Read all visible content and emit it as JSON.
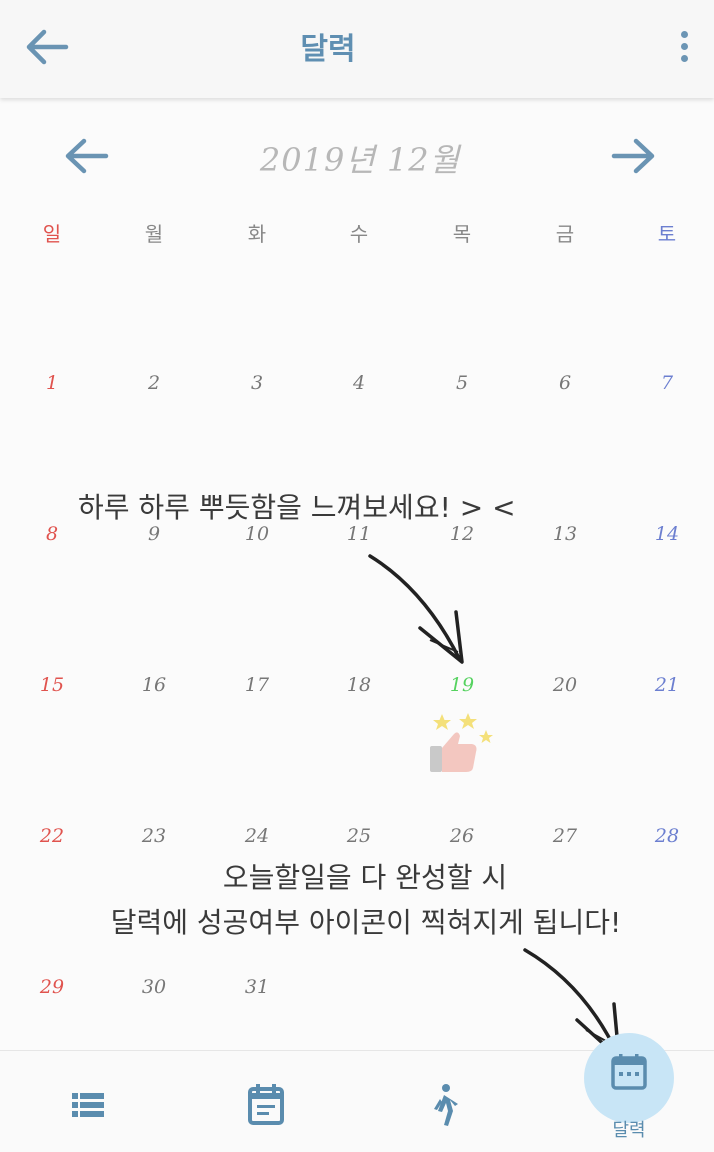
{
  "header": {
    "title": "달력",
    "back_icon": "arrow-left-icon",
    "more_icon": "more-vertical-icon"
  },
  "month_nav": {
    "label": "2019년 12월",
    "prev_icon": "arrow-left-icon",
    "next_icon": "arrow-right-icon"
  },
  "weekdays": [
    "일",
    "월",
    "화",
    "수",
    "목",
    "금",
    "토"
  ],
  "weeks": [
    [
      "1",
      "2",
      "3",
      "4",
      "5",
      "6",
      "7"
    ],
    [
      "8",
      "9",
      "10",
      "11",
      "12",
      "13",
      "14"
    ],
    [
      "15",
      "16",
      "17",
      "18",
      "19",
      "20",
      "21"
    ],
    [
      "22",
      "23",
      "24",
      "25",
      "26",
      "27",
      "28"
    ],
    [
      "29",
      "30",
      "31",
      "",
      "",
      "",
      ""
    ]
  ],
  "today": "19",
  "success_badge_icon": "thumbs-up-stars-icon",
  "tips": {
    "tip1": "하루 하루 뿌듯함을 느껴보세요! > <",
    "tip2_line1": "오늘할일을 다 완성할 시",
    "tip2_line2": "달력에 성공여부 아이콘이 찍혀지게 됩니다!"
  },
  "bottom_nav": {
    "items": [
      {
        "icon": "list-icon",
        "label": ""
      },
      {
        "icon": "calendar-note-icon",
        "label": ""
      },
      {
        "icon": "walking-person-icon",
        "label": ""
      },
      {
        "icon": "calendar-icon",
        "label": "달력"
      }
    ],
    "active_label": "달력"
  },
  "colors": {
    "accent": "#5f8fb2",
    "sunday": "#e0534e",
    "saturday": "#6c7fd0",
    "today": "#55d25f",
    "active_nav_bg": "#c8e5f6"
  }
}
